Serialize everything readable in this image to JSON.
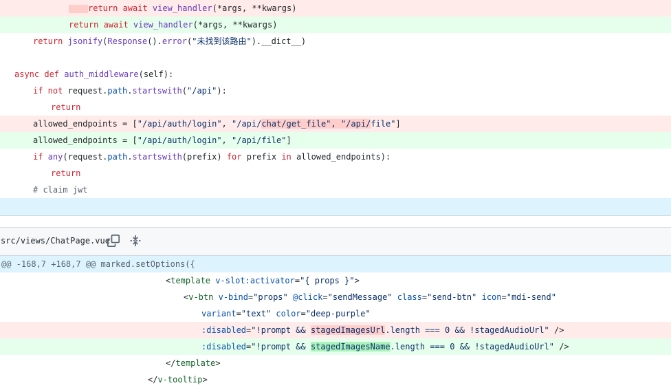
{
  "top_diff": {
    "lines": [
      {
        "type": "del",
        "t1": "return await ",
        "t2": "view_handler",
        "t3": "(*args, **kwargs)"
      },
      {
        "type": "add",
        "t1": "return await ",
        "t2": "view_handler",
        "t3": "(*args, **kwargs)"
      },
      {
        "type": "ctx",
        "text_a": "return ",
        "text_b": "jsonify",
        "text_c": "(",
        "text_d": "Response",
        "text_e": "().",
        "text_f": "error",
        "text_g": "(",
        "text_h": "\"未找到该路由\"",
        "text_i": ").__dict__)"
      },
      {
        "type": "blank"
      },
      {
        "type": "ctx",
        "kw1": "async def ",
        "fn": "auth_middleware",
        "rest": "(self):"
      },
      {
        "type": "ctx",
        "kw1": "if not ",
        "t1": "request.",
        "t2": "path",
        "t3": ".",
        "t4": "startswith",
        "t5": "(",
        "t6": "\"/api\"",
        "t7": "):"
      },
      {
        "type": "ctx",
        "kw1": "return"
      },
      {
        "type": "del",
        "t1": "allowed_endpoints = [",
        "s1": "\"/api/auth/login\"",
        "t2": ", ",
        "s2a": "\"/api/",
        "s2b": "chat/get_file\", \"/api/",
        "s2c": "file\"",
        "t3": "]"
      },
      {
        "type": "add",
        "t1": "allowed_endpoints = [",
        "s1": "\"/api/auth/login\"",
        "t2": ", ",
        "s2": "\"/api/file\"",
        "t3": "]"
      },
      {
        "type": "ctx",
        "kw1": "if ",
        "fn1": "any",
        "t1": "(request.",
        "t2": "path",
        "t3": ".",
        "fn2": "startswith",
        "t4": "(prefix) ",
        "kw2": "for",
        "t5": " prefix ",
        "kw3": "in",
        "t6": " allowed_endpoints):"
      },
      {
        "type": "ctx",
        "kw1": "return"
      },
      {
        "type": "ctx",
        "cm": "# claim jwt"
      }
    ]
  },
  "file": {
    "name": "src/views/ChatPage.vue",
    "copy_icon": "copy-icon",
    "expand_icon": "expand-icon"
  },
  "hunk": {
    "header": "@@ -168,7 +168,7 @@ marked.setOptions({"
  },
  "bottom_diff": {
    "l1": {
      "a": "<",
      "tag": "template",
      "b": " ",
      "attr": "v-slot:activator",
      "c": "=",
      "s": "\"{ props }\"",
      "d": ">"
    },
    "l2": {
      "a": "<",
      "tag": "v-btn",
      "sp1": " ",
      "attr1": "v-bind",
      "eq1": "=",
      "s1": "\"props\"",
      "sp2": " ",
      "attr2": "@click",
      "eq2": "=",
      "s2": "\"sendMessage\"",
      "sp3": " ",
      "attr3": "class",
      "eq3": "=",
      "s3": "\"send-btn\"",
      "sp4": " ",
      "attr4": "icon",
      "eq4": "=",
      "s4": "\"mdi-send\""
    },
    "l3": {
      "attr1": "variant",
      "eq1": "=",
      "s1": "\"text\"",
      "sp": " ",
      "attr2": "color",
      "eq2": "=",
      "s2": "\"deep-purple\""
    },
    "l4": {
      "attr": ":disabled",
      "eq": "=",
      "s1": "\"!prompt && ",
      "hl": "stagedImagesUrl",
      "s2": ".length === 0 && !stagedAudioUrl\"",
      "end": " />"
    },
    "l5": {
      "attr": ":disabled",
      "eq": "=",
      "s1": "\"!prompt && ",
      "hl": "stagedImagesName",
      "s2": ".length === 0 && !stagedAudioUrl\"",
      "end": " />"
    },
    "l6": {
      "a": "</",
      "tag": "template",
      "b": ">"
    },
    "l7": {
      "a": "</",
      "tag": "v-tooltip",
      "b": ">"
    }
  }
}
